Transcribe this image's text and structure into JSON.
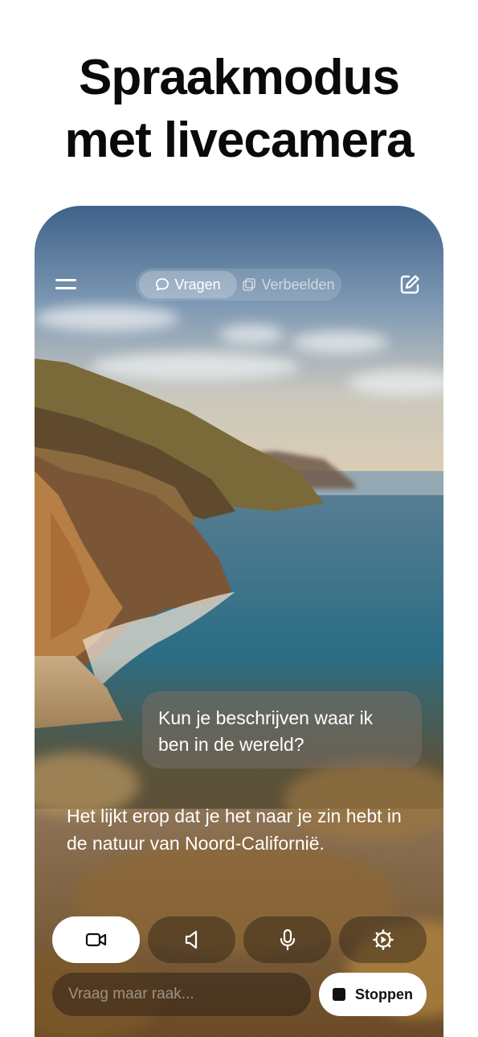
{
  "headline": {
    "line1": "Spraakmodus",
    "line2": "met livecamera"
  },
  "topbar": {
    "tab_ask": "Vragen",
    "tab_examples": "Verbeelden"
  },
  "conversation": {
    "user_message": "Kun je beschrijven waar ik ben in de wereld?",
    "assistant_message": "Het lijkt erop dat je het naar je zin hebt in de natuur van Noord-Californië."
  },
  "controls": {
    "camera_icon": "video-camera-icon",
    "speaker_icon": "speaker-icon",
    "mic_icon": "microphone-icon",
    "settings_icon": "gear-icon"
  },
  "input": {
    "placeholder": "Vraag maar raak...",
    "value": ""
  },
  "stop_button": {
    "label": "Stoppen"
  },
  "colors": {
    "background": "#ffffff",
    "headline": "#0a0a0a",
    "sky_top": "#4a6d93",
    "sea": "#2f7c8c",
    "cliff": "#7a5a3a"
  }
}
